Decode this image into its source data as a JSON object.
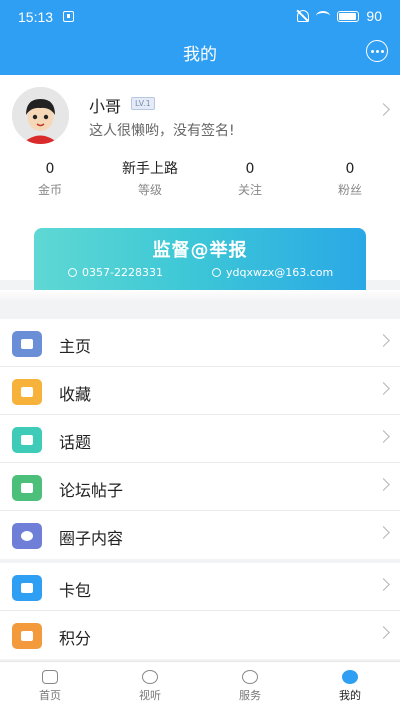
{
  "status_bar": {
    "time": "15:13",
    "battery": "90"
  },
  "header": {
    "title": "我的"
  },
  "profile": {
    "username": "小哥",
    "level": "LV.1",
    "signature": "这人很懒哟，没有签名!",
    "stats": [
      {
        "value": "0",
        "label": "金币"
      },
      {
        "value": "新手上路",
        "label": "等级"
      },
      {
        "value": "0",
        "label": "关注"
      },
      {
        "value": "0",
        "label": "粉丝"
      }
    ]
  },
  "banner": {
    "title": "监督@举报",
    "phone": "0357-2228331",
    "email": "ydqxwzx@163.com"
  },
  "menu_group_1": [
    {
      "label": "主页",
      "icon": "image-icon",
      "color": "#6b8fd6"
    },
    {
      "label": "收藏",
      "icon": "box-icon",
      "color": "#f6b23a"
    },
    {
      "label": "话题",
      "icon": "hashtag-icon",
      "color": "#3ecbb7"
    },
    {
      "label": "论坛帖子",
      "icon": "chat-icon",
      "color": "#4cbf7a"
    },
    {
      "label": "圈子内容",
      "icon": "circle-icon",
      "color": "#6f7fd8"
    }
  ],
  "menu_group_2": [
    {
      "label": "卡包",
      "icon": "wallet-icon",
      "color": "#2f9ff3"
    },
    {
      "label": "积分",
      "icon": "coins-icon",
      "color": "#f29a3c"
    }
  ],
  "tabbar": [
    {
      "label": "首页",
      "icon": "home-icon",
      "active": false
    },
    {
      "label": "视听",
      "icon": "play-icon",
      "active": false
    },
    {
      "label": "服务",
      "icon": "service-icon",
      "active": false
    },
    {
      "label": "我的",
      "icon": "profile-icon",
      "active": true
    }
  ],
  "colors": {
    "accent": "#2f9ff3",
    "background": "#f2f3f5"
  }
}
